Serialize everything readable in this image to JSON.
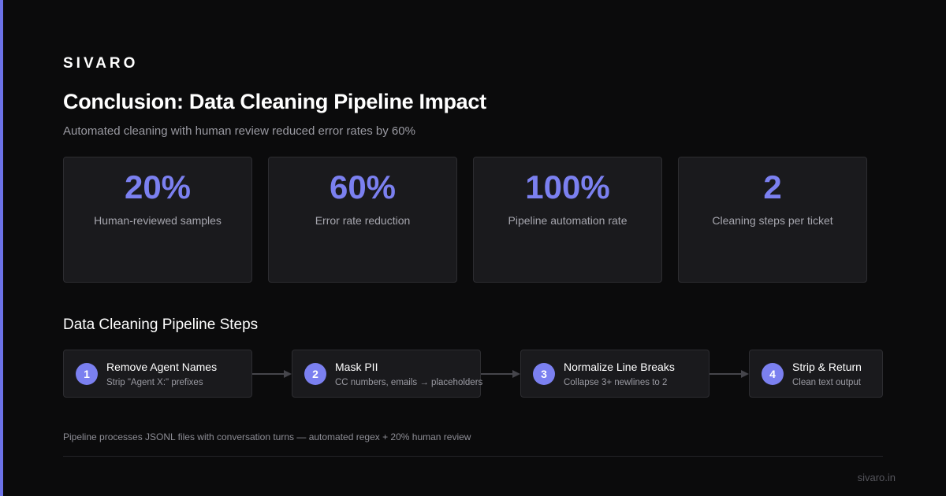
{
  "brand": "SIVARO",
  "title": "Conclusion: Data Cleaning Pipeline Impact",
  "subtitle": "Automated cleaning with human review reduced error rates by 60%",
  "stats": [
    {
      "value": "20%",
      "label": "Human-reviewed samples"
    },
    {
      "value": "60%",
      "label": "Error rate reduction"
    },
    {
      "value": "100%",
      "label": "Pipeline automation rate"
    },
    {
      "value": "2",
      "label": "Cleaning steps per ticket"
    }
  ],
  "pipeline": {
    "heading": "Data Cleaning Pipeline Steps",
    "steps": [
      {
        "num": "1",
        "title": "Remove Agent Names",
        "desc": "Strip \"Agent X:\" prefixes"
      },
      {
        "num": "2",
        "title": "Mask PII",
        "desc": "CC numbers, emails → placeholders"
      },
      {
        "num": "3",
        "title": "Normalize Line Breaks",
        "desc": "Collapse 3+ newlines to 2"
      },
      {
        "num": "4",
        "title": "Strip & Return",
        "desc": "Clean text output"
      }
    ]
  },
  "footer_note": "Pipeline processes JSONL files with conversation turns — automated regex + 20% human review",
  "site": "sivaro.in",
  "colors": {
    "accent": "#7b80f0",
    "background": "#0b0b0c",
    "card": "#1a1a1d"
  },
  "icons": {
    "arrow": "arrow-right-icon"
  }
}
